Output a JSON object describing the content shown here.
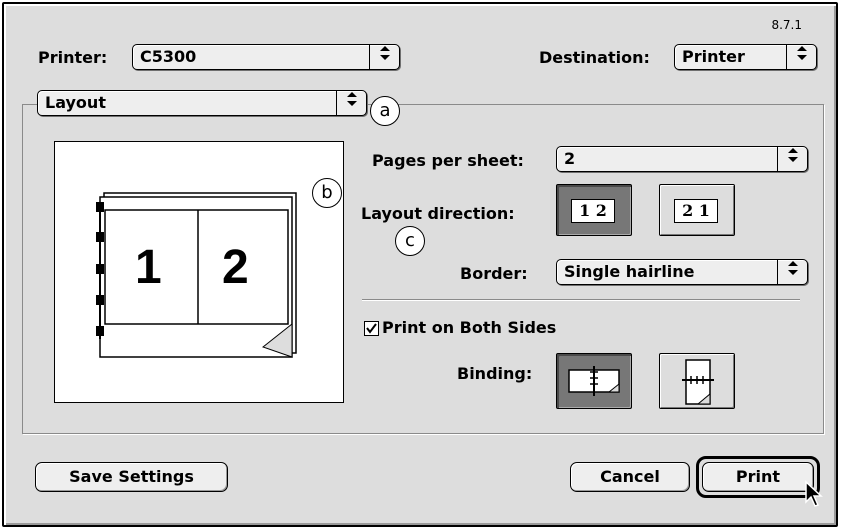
{
  "version": "8.7.1",
  "printer": {
    "label": "Printer:",
    "value": "C5300"
  },
  "destination": {
    "label": "Destination:",
    "value": "Printer"
  },
  "panel_menu": {
    "value": "Layout"
  },
  "annotations": {
    "a": "a",
    "b": "b",
    "c": "c"
  },
  "preview": {
    "page_left": "1",
    "page_right": "2"
  },
  "pages_per_sheet": {
    "label": "Pages per sheet:",
    "value": "2"
  },
  "layout_direction": {
    "label": "Layout direction:",
    "options": [
      {
        "text": "1 2",
        "selected": true
      },
      {
        "text": "2 1",
        "selected": false
      }
    ]
  },
  "border": {
    "label": "Border:",
    "value": "Single hairline"
  },
  "both_sides": {
    "label": "Print on Both Sides",
    "checked": true
  },
  "binding": {
    "label": "Binding:",
    "selected": "long-edge"
  },
  "buttons": {
    "save": "Save Settings",
    "cancel": "Cancel",
    "print": "Print"
  },
  "icons": {
    "popup_arrow": "updown-arrows-icon",
    "checkmark": "checkmark-icon",
    "cursor": "mouse-pointer-icon"
  }
}
